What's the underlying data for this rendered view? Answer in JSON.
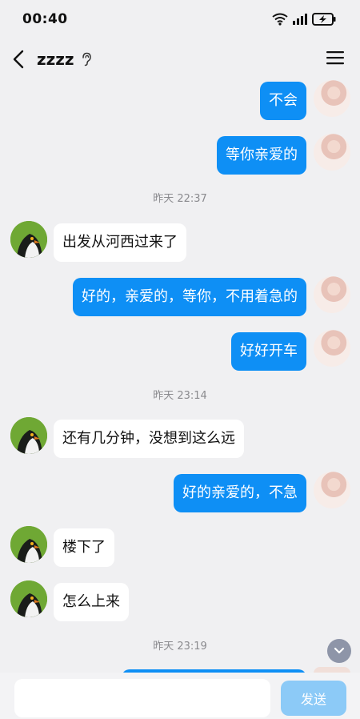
{
  "status_bar": {
    "time": "00:40"
  },
  "header": {
    "title": "zzzz"
  },
  "messages": [
    {
      "text": "不会"
    },
    {
      "text": "等你亲爱的"
    },
    {
      "text": "昨天 22:37"
    },
    {
      "text": "出发从河西过来了"
    },
    {
      "text": "好的，亲爱的，等你，不用着急的"
    },
    {
      "text": "好好开车"
    },
    {
      "text": "昨天 23:14"
    },
    {
      "text": "还有几分钟，没想到这么远"
    },
    {
      "text": "好的亲爱的，不急"
    },
    {
      "text": "楼下了"
    },
    {
      "text": "怎么上来"
    },
    {
      "text": "昨天 23:19"
    }
  ],
  "composer": {
    "send_label": "发送"
  },
  "colors": {
    "outgoing_bubble": "#0e8ff5",
    "incoming_bubble": "#ffffff",
    "background": "#f0f0f2"
  }
}
